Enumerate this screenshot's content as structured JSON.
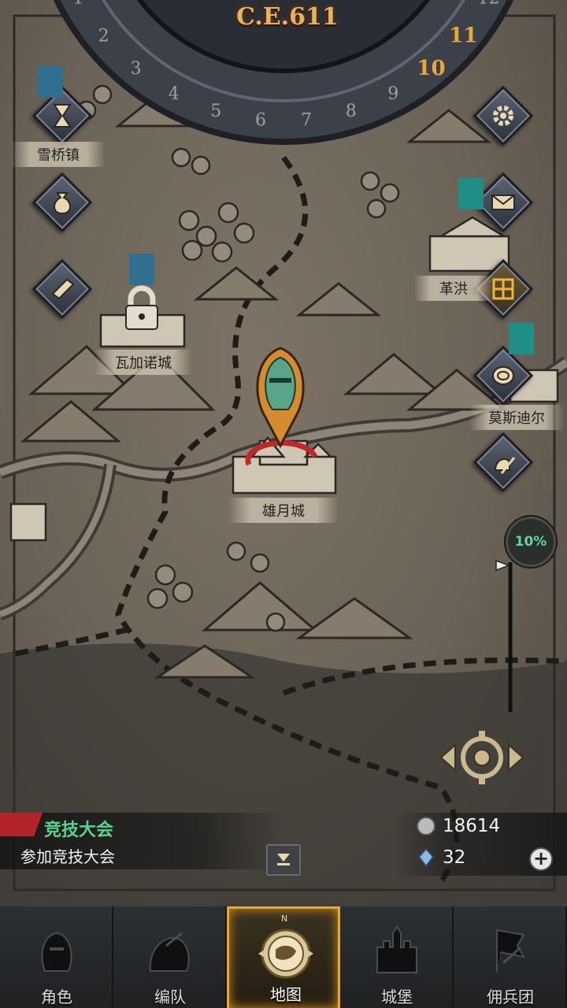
{
  "header": {
    "era": "C.E.611",
    "months": [
      "1",
      "2",
      "3",
      "4",
      "5",
      "6",
      "7",
      "8",
      "9",
      "10",
      "11",
      "12"
    ],
    "current_months": [
      "10",
      "11"
    ]
  },
  "towns": {
    "snow_bridge": "雪桥镇",
    "vagano": "瓦加诺城",
    "bear_moon": "雄月城",
    "gekwa": "革洪",
    "moschdir": "莫斯迪尔"
  },
  "progress": {
    "percent_label": "10%",
    "value": 0.1
  },
  "event": {
    "title": "竞技大会",
    "subtitle": "参加竞技大会"
  },
  "resources": {
    "silver": "18614",
    "crystal": "32"
  },
  "side_buttons": {
    "left": [
      "hourglass-icon",
      "money-bag-icon",
      "scroll-icon"
    ],
    "right": [
      "gear-icon",
      "mail-icon",
      "storage-icon",
      "coin-icon",
      "knight-sword-icon"
    ]
  },
  "nav": {
    "items": [
      {
        "label": "角色",
        "icon": "knight-helmet-icon"
      },
      {
        "label": "编队",
        "icon": "squad-icon"
      },
      {
        "label": "地图",
        "icon": "compass-map-icon",
        "active": true
      },
      {
        "label": "城堡",
        "icon": "castle-icon"
      },
      {
        "label": "佣兵团",
        "icon": "mercenary-flag-icon"
      }
    ],
    "compass_letter": "N"
  },
  "colors": {
    "accent_gold": "#e8a838",
    "event_green": "#58d48c",
    "progress_teal": "#5ed6a4",
    "map_parchment": "#6b6357"
  }
}
